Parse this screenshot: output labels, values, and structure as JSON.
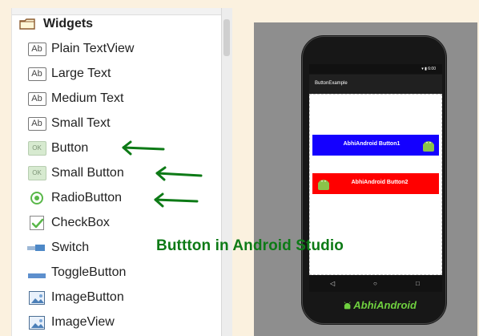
{
  "palette": {
    "group_title": "Widgets",
    "items": [
      {
        "label": "Plain TextView",
        "icon": "text-icon",
        "icon_text": "Ab"
      },
      {
        "label": "Large Text",
        "icon": "text-icon",
        "icon_text": "Ab"
      },
      {
        "label": "Medium Text",
        "icon": "text-icon",
        "icon_text": "Ab"
      },
      {
        "label": "Small Text",
        "icon": "text-icon",
        "icon_text": "Ab"
      },
      {
        "label": "Button",
        "icon": "button-icon",
        "icon_text": "OK"
      },
      {
        "label": "Small Button",
        "icon": "button-icon",
        "icon_text": "OK"
      },
      {
        "label": "RadioButton",
        "icon": "radio-icon"
      },
      {
        "label": "CheckBox",
        "icon": "checkbox-icon"
      },
      {
        "label": "Switch",
        "icon": "switch-icon"
      },
      {
        "label": "ToggleButton",
        "icon": "toggle-icon"
      },
      {
        "label": "ImageButton",
        "icon": "image-button-icon"
      },
      {
        "label": "ImageView",
        "icon": "image-view-icon"
      }
    ]
  },
  "device": {
    "app_title": "ButtonExample",
    "buttons": [
      {
        "label": "AbhiAndroid Button1",
        "color": "#1400ff"
      },
      {
        "label": "AbhiAndroid Button2",
        "color": "#ff0000"
      }
    ],
    "brand_text": "AbhiAndroid",
    "status_icons": "▾ ▮ 6:00"
  },
  "caption": "Buttton in Android Studio",
  "colors": {
    "arrow": "#0d7a16",
    "android_green": "#8bc34a",
    "background": "#fbf1df"
  }
}
